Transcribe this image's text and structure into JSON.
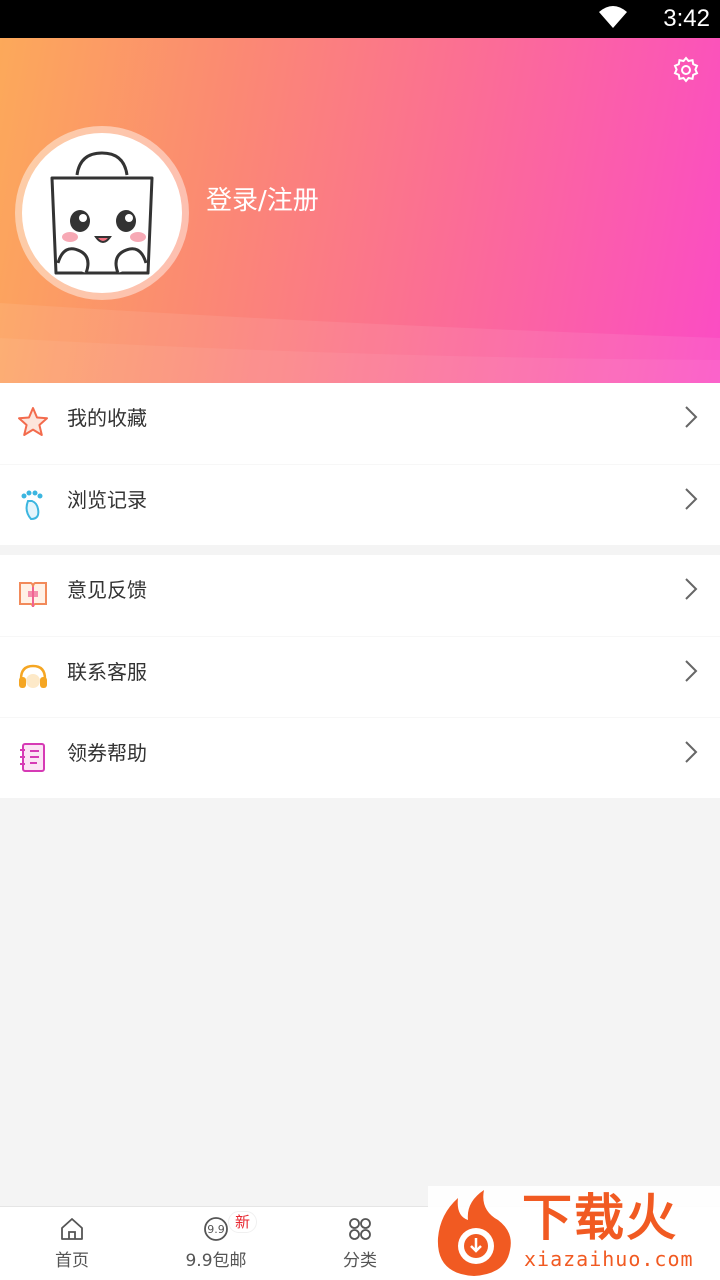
{
  "status_bar": {
    "time": "3:42"
  },
  "header": {
    "login_label": "登录/注册"
  },
  "menu": {
    "group1": [
      {
        "label": "我的收藏",
        "icon": "star-icon"
      },
      {
        "label": "浏览记录",
        "icon": "footprint-icon"
      }
    ],
    "group2": [
      {
        "label": "意见反馈",
        "icon": "feedback-book-icon"
      },
      {
        "label": "联系客服",
        "icon": "headset-icon"
      },
      {
        "label": "领券帮助",
        "icon": "notebook-icon"
      }
    ]
  },
  "tabbar": {
    "tabs": [
      {
        "label": "首页",
        "icon": "home-icon"
      },
      {
        "label": "9.9包邮",
        "icon": "nine-nine-icon",
        "badge": "新"
      },
      {
        "label": "分类",
        "icon": "category-grid-icon"
      }
    ]
  },
  "watermark": {
    "title": "下载火",
    "url": "xiazaihuo.com"
  },
  "colors": {
    "gradient_start": "#fca95a",
    "gradient_end": "#fb4cc4",
    "badge_red": "#e8262f",
    "watermark_orange": "#f15a22"
  }
}
